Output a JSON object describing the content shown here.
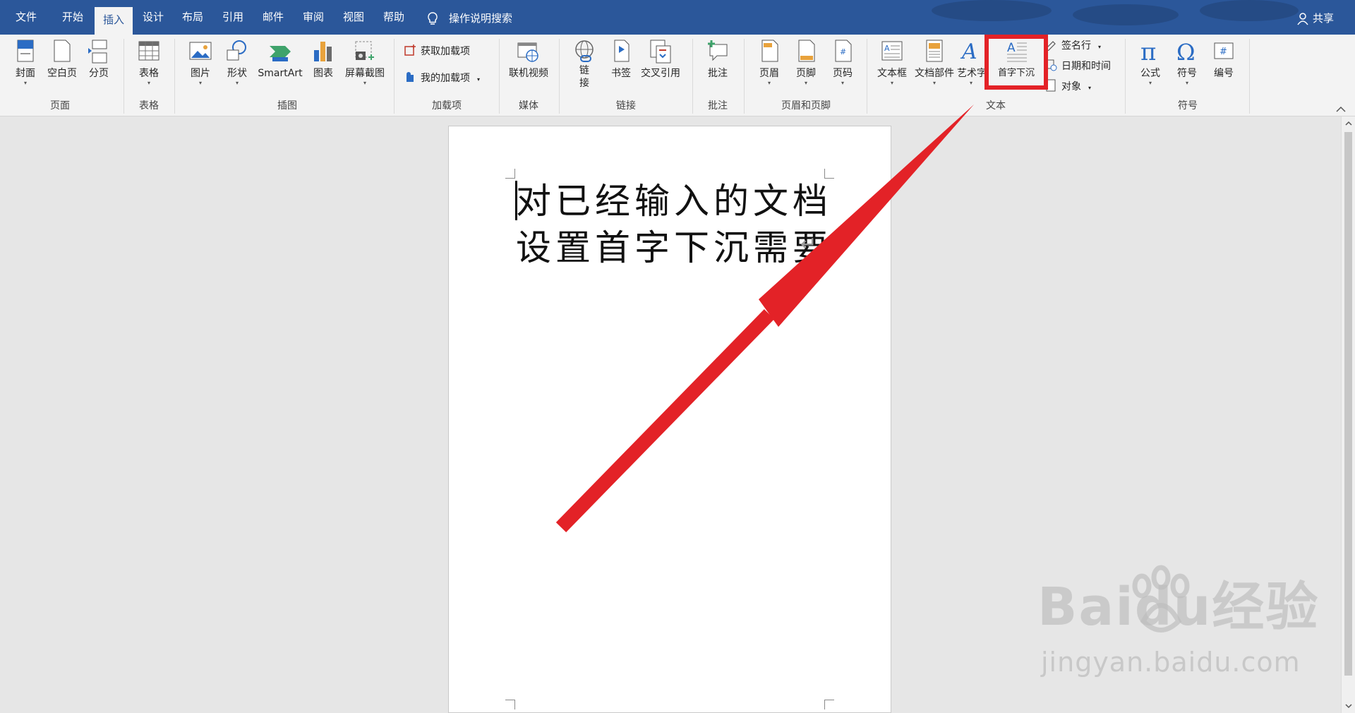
{
  "tabs": [
    "文件",
    "开始",
    "插入",
    "设计",
    "布局",
    "引用",
    "邮件",
    "审阅",
    "视图",
    "帮助"
  ],
  "active_tab": "插入",
  "tell_me": "操作说明搜索",
  "share": "共享",
  "ribbon": {
    "pages": {
      "cover": "封面",
      "blank": "空白页",
      "break": "分页",
      "group": "页面"
    },
    "tables": {
      "table": "表格",
      "group": "表格"
    },
    "illustrations": {
      "picture": "图片",
      "shapes": "形状",
      "smartart": "SmartArt",
      "chart": "图表",
      "screenshot": "屏幕截图",
      "group": "插图"
    },
    "addins": {
      "get": "获取加载项",
      "mine": "我的加载项",
      "group": "加载项"
    },
    "media": {
      "video": "联机视频",
      "group": "媒体"
    },
    "links": {
      "link_line1": "链",
      "link_line2": "接",
      "bookmark": "书签",
      "crossref": "交叉引用",
      "group": "链接"
    },
    "comments": {
      "comment": "批注",
      "group": "批注"
    },
    "header_footer": {
      "header": "页眉",
      "footer": "页脚",
      "page_number": "页码",
      "group": "页眉和页脚"
    },
    "text": {
      "textbox": "文本框",
      "quickparts": "文档部件",
      "wordart": "艺术字",
      "dropcap": "首字下沉",
      "signature": "签名行",
      "datetime": "日期和时间",
      "object": "对象",
      "group": "文本"
    },
    "symbols": {
      "equation": "公式",
      "symbol": "符号",
      "number": "编号",
      "group": "符号"
    }
  },
  "document": {
    "line1": "对已经输入的文档",
    "line2": "设置首字下沉需要",
    "para_mark": "↵"
  },
  "watermark": {
    "brand": "Baidu经验",
    "url": "jingyan.baidu.com"
  },
  "colors": {
    "title_bar": "#2b579a",
    "highlight": "#e32227"
  }
}
